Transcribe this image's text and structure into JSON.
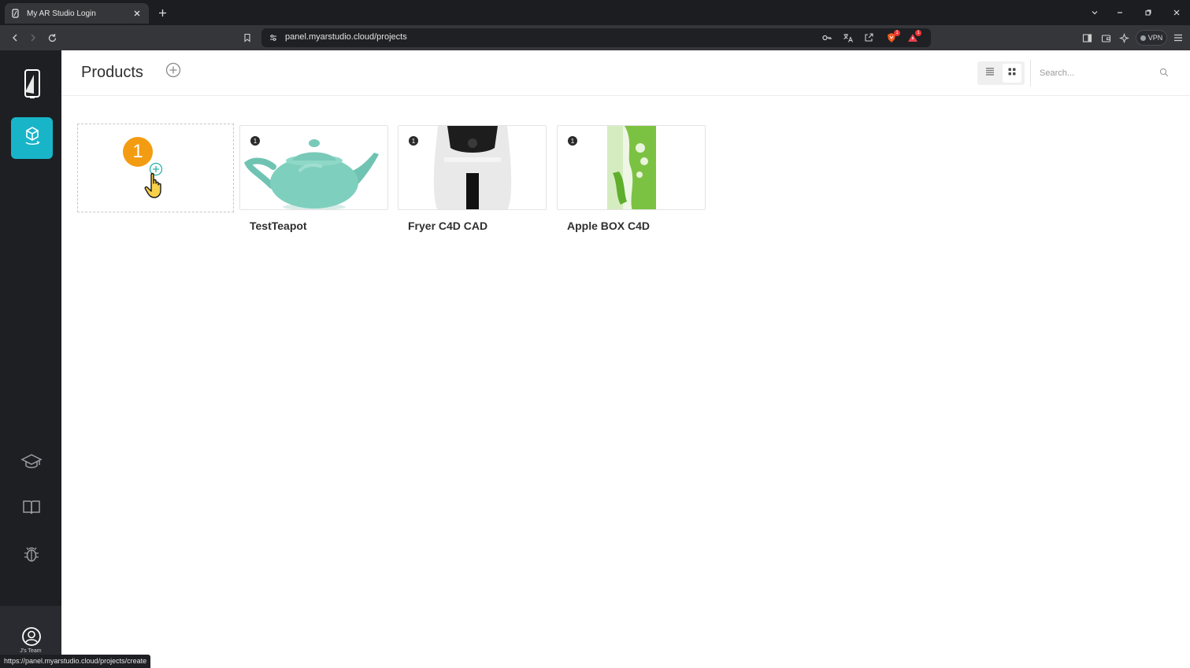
{
  "browser": {
    "tab_title": "My AR Studio Login",
    "url": "panel.myarstudio.cloud/projects",
    "shield_count": "1",
    "alert_count": "1",
    "vpn_label": "VPN"
  },
  "sidebar": {
    "items": [
      {
        "name": "logo",
        "icon": "phone-logo-icon"
      },
      {
        "name": "products",
        "icon": "cube-ar-icon",
        "active": true
      },
      {
        "name": "academy",
        "icon": "graduation-cap-icon"
      },
      {
        "name": "docs",
        "icon": "book-icon"
      },
      {
        "name": "report-bug",
        "icon": "bug-icon"
      }
    ],
    "account_label": "J's Team",
    "active_color": "#18b5c8"
  },
  "header": {
    "title": "Products",
    "search_placeholder": "Search..."
  },
  "create_card": {
    "step_number": "1"
  },
  "products": [
    {
      "title": "TestTeapot",
      "count": "1"
    },
    {
      "title": "Fryer C4D CAD",
      "count": "1"
    },
    {
      "title": "Apple BOX C4D",
      "count": "1"
    }
  ],
  "status_url": "https://panel.myarstudio.cloud/projects/create"
}
